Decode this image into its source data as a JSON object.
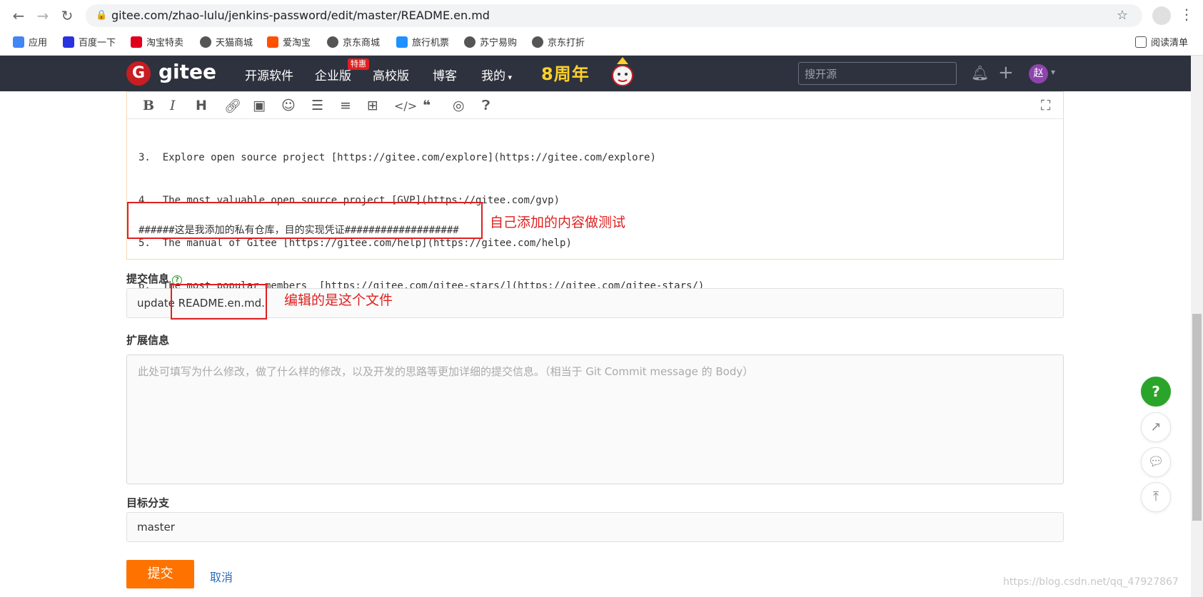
{
  "browser": {
    "url": "gitee.com/zhao-lulu/jenkins-password/edit/master/README.en.md",
    "bookmarks": [
      "应用",
      "百度一下",
      "淘宝特卖",
      "天猫商城",
      "爱淘宝",
      "京东商城",
      "旅行机票",
      "苏宁易购",
      "京东打折"
    ],
    "reading_list": "阅读清单"
  },
  "gitee_nav": {
    "logo": "gitee",
    "items": [
      "开源软件",
      "企业版",
      "高校版",
      "博客",
      "我的"
    ],
    "hot_badge": "特惠",
    "anniversary": "8周年",
    "search_placeholder": "搜开源",
    "user_initial": "赵"
  },
  "editor": {
    "lines": [
      "3.  Explore open source project [https://gitee.com/explore](https://gitee.com/explore)",
      "4.  The most valuable open source project [GVP](https://gitee.com/gvp)",
      "5.  The manual of Gitee [https://gitee.com/help](https://gitee.com/help)",
      "6.  The most popular members  [https://gitee.com/gitee-stars/](https://gitee.com/gitee-stars/)"
    ],
    "custom_line": "######这是我添加的私有仓库，目的实现凭证###################"
  },
  "annotations": {
    "custom_content": "自己添加的内容做测试",
    "edited_file": "编辑的是这个文件"
  },
  "form": {
    "commit_label": "提交信息",
    "commit_value": "update README.en.md.",
    "ext_label": "扩展信息",
    "ext_placeholder": "此处可填写为什么修改，做了什么样的修改，以及开发的思路等更加详细的提交信息。（相当于 Git Commit message 的 Body）",
    "branch_label": "目标分支",
    "branch_value": "master",
    "submit": "提交",
    "cancel": "取消"
  },
  "watermark": "https://blog.csdn.net/qq_47927867",
  "colors": {
    "accent": "#fe7300",
    "nav_bg": "#2e323e",
    "annotation": "#e02020",
    "help": "#2aa52a"
  }
}
